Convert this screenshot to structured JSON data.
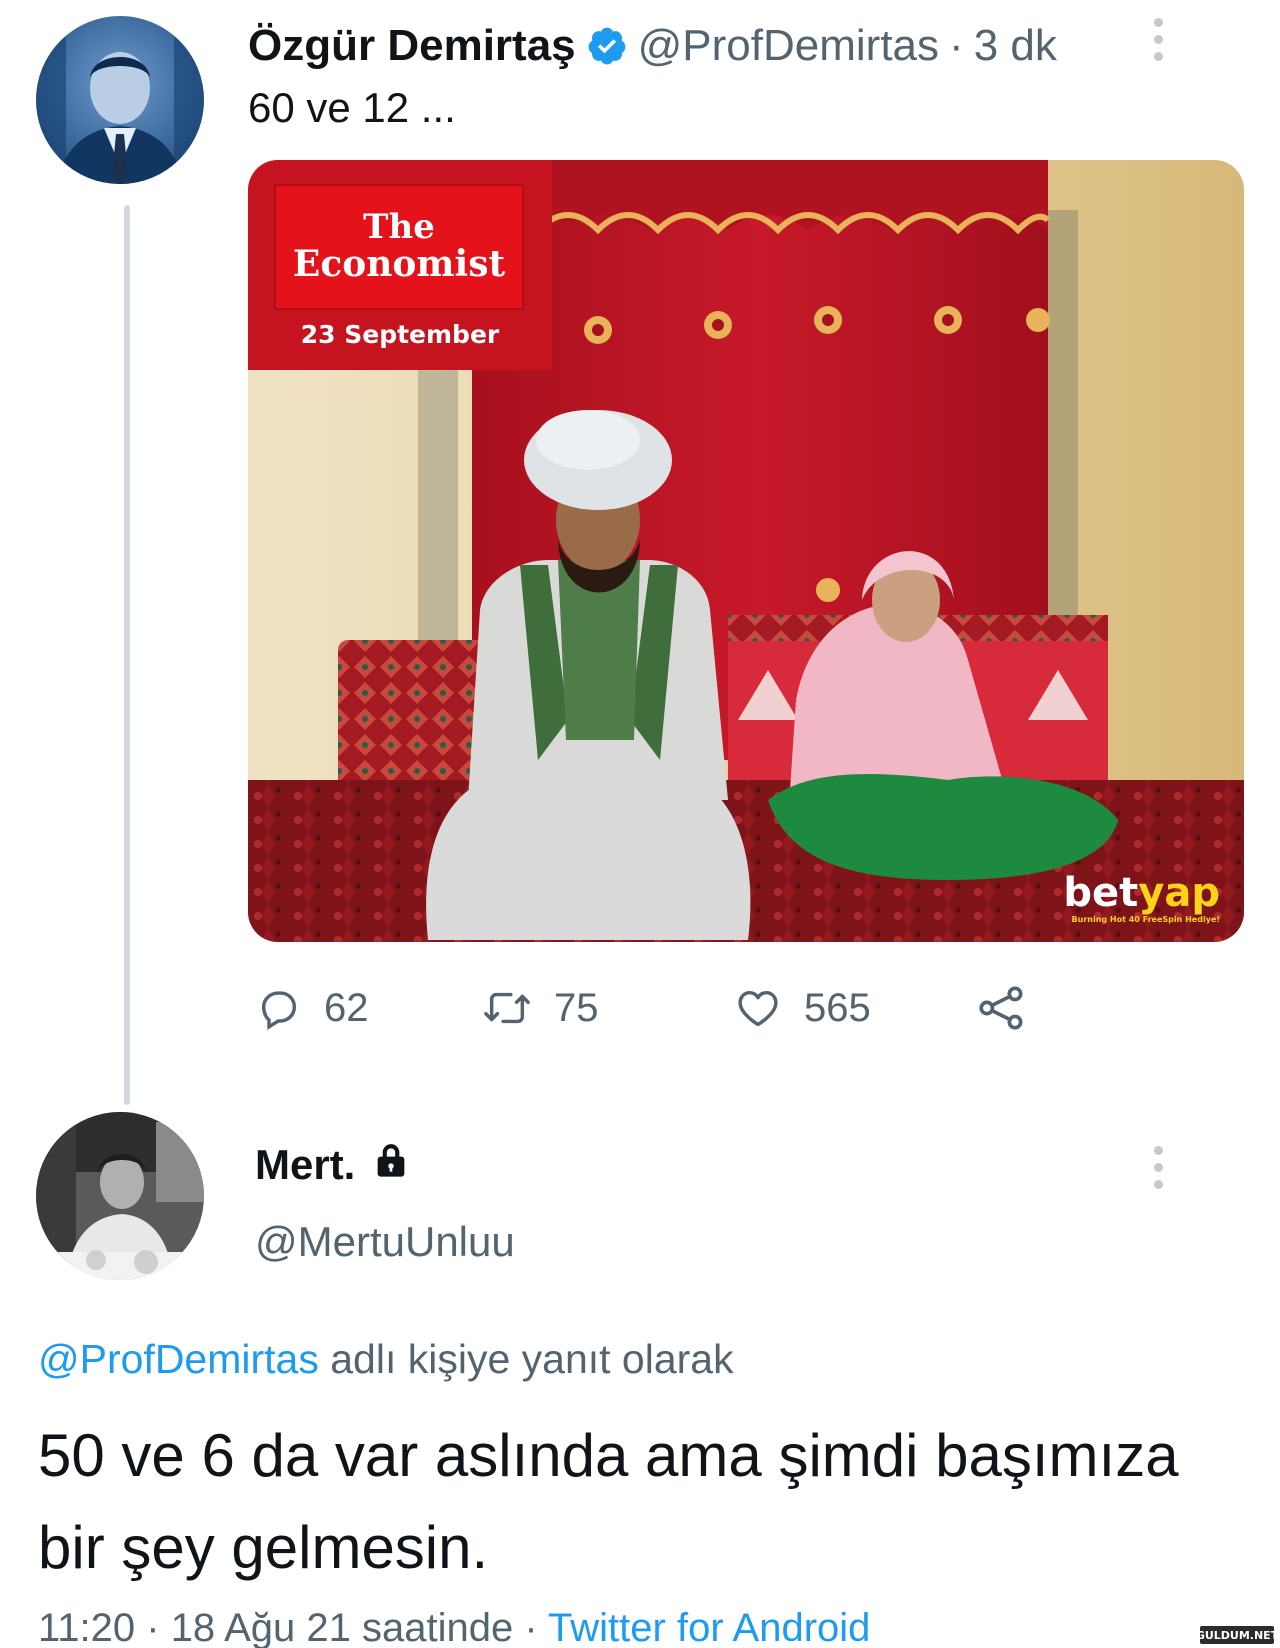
{
  "tweet1": {
    "author_name": "Özgür Demirtaş",
    "handle": "@ProfDemirtas",
    "separator": "·",
    "time_ago": "3 dk",
    "text": "60 ve 12 ...",
    "media": {
      "brand_line1": "The",
      "brand_line2": "Economist",
      "date": "23 September",
      "watermark_part1": "bet",
      "watermark_part2": "yap",
      "watermark_tagline": "Burning Hot 40 FreeSpin Hediye!"
    },
    "actions": {
      "replies": "62",
      "retweets": "75",
      "likes": "565"
    }
  },
  "tweet2": {
    "author_name": "Mert.",
    "handle": "@MertuUnluu",
    "replying_mention": "@ProfDemirtas",
    "replying_suffix": " adlı kişiye yanıt olarak",
    "text": "50 ve 6 da var aslında ama şimdi başımıza bir şey gelmesin.",
    "time": "11:20",
    "separator": " · ",
    "date": "18 Ağu 21 saatinde",
    "separator2": " · ",
    "source": "Twitter for Android"
  },
  "site_badge": "GULDUM.NET",
  "colors": {
    "link_blue": "#1d9bf0",
    "secondary_text": "#536471",
    "economist_red": "#e3121b",
    "thread_line": "#cfd9de"
  },
  "icons": [
    "verified-badge-icon",
    "more-options-icon",
    "reply-icon",
    "retweet-icon",
    "like-icon",
    "share-icon",
    "lock-icon"
  ]
}
